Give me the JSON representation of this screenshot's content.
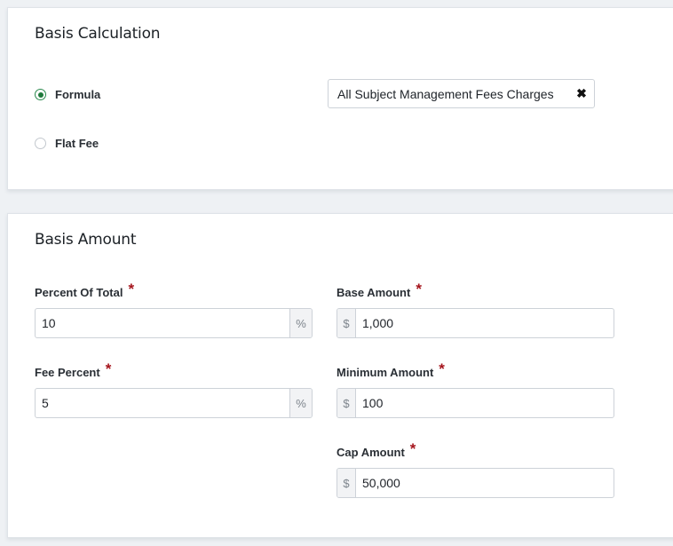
{
  "basis_calculation": {
    "title": "Basis Calculation",
    "options": [
      {
        "label": "Formula",
        "checked": true
      },
      {
        "label": "Flat Fee",
        "checked": false
      }
    ],
    "selected_charge": "All Subject Management Fees Charges",
    "clear_icon": "×-icon"
  },
  "basis_amount": {
    "title": "Basis Amount",
    "required_marker": "*",
    "fields": {
      "percent_of_total": {
        "label": "Percent Of Total",
        "value": "10",
        "suffix": "%"
      },
      "fee_percent": {
        "label": "Fee Percent",
        "value": "5",
        "suffix": "%"
      },
      "base_amount": {
        "label": "Base Amount",
        "value": "1,000",
        "prefix": "$"
      },
      "minimum_amount": {
        "label": "Minimum Amount",
        "value": "100",
        "prefix": "$"
      },
      "cap_amount": {
        "label": "Cap Amount",
        "value": "50,000",
        "prefix": "$"
      }
    }
  },
  "colors": {
    "accent_green": "#1f7a3c",
    "required_red": "#a5141c",
    "page_bg": "#eef1f4"
  }
}
